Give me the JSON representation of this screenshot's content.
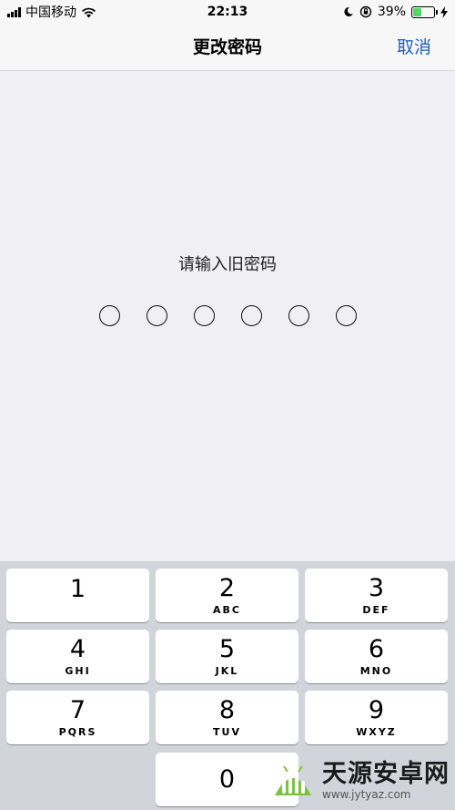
{
  "status_bar": {
    "carrier": "中国移动",
    "time": "22:13",
    "battery_percent": "39%",
    "battery_level": 0.39,
    "icons": [
      "signal-icon",
      "wifi-icon",
      "moon-icon",
      "orientation-lock-icon",
      "battery-icon",
      "charging-bolt-icon"
    ]
  },
  "nav": {
    "title": "更改密码",
    "cancel_label": "取消"
  },
  "prompt": {
    "text": "请输入旧密码",
    "dot_count": 6
  },
  "keypad": {
    "keys": [
      {
        "num": "1",
        "letters": ""
      },
      {
        "num": "2",
        "letters": "ABC"
      },
      {
        "num": "3",
        "letters": "DEF"
      },
      {
        "num": "4",
        "letters": "GHI"
      },
      {
        "num": "5",
        "letters": "JKL"
      },
      {
        "num": "6",
        "letters": "MNO"
      },
      {
        "num": "7",
        "letters": "PQRS"
      },
      {
        "num": "8",
        "letters": "TUV"
      },
      {
        "num": "9",
        "letters": "WXYZ"
      },
      {
        "num": "0",
        "letters": ""
      }
    ]
  },
  "watermark": {
    "name": "天源安卓网",
    "url": "www.jytyaz.com"
  },
  "colors": {
    "accent": "#1f5fc4",
    "background": "#efeff4",
    "keypad_bg": "#d1d4da",
    "battery_fill": "#4cd964"
  }
}
